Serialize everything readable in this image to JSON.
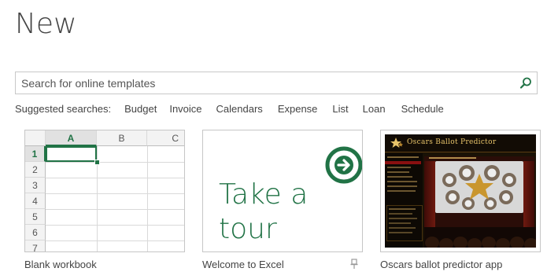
{
  "page": {
    "title": "New"
  },
  "search": {
    "placeholder": "Search for online templates"
  },
  "suggested": {
    "label": "Suggested searches:",
    "items": [
      "Budget",
      "Invoice",
      "Calendars",
      "Expense",
      "List",
      "Loan",
      "Schedule"
    ]
  },
  "templates": [
    {
      "caption": "Blank workbook",
      "columns": [
        "A",
        "B",
        "C"
      ],
      "rows": [
        "1",
        "2",
        "3",
        "4",
        "5",
        "6",
        "7"
      ],
      "selected_column": "A",
      "selected_row": "1"
    },
    {
      "caption": "Welcome to Excel",
      "tour_line1": "Take a",
      "tour_line2": "tour",
      "icons": [
        "arrow-right-circle-icon",
        "pin-icon"
      ]
    },
    {
      "caption": "Oscars ballot predictor app",
      "banner_title": "Oscars Ballot Predictor"
    }
  ],
  "colors": {
    "accent": "#217346",
    "text": "#444444",
    "border": "#c6c6c6"
  }
}
